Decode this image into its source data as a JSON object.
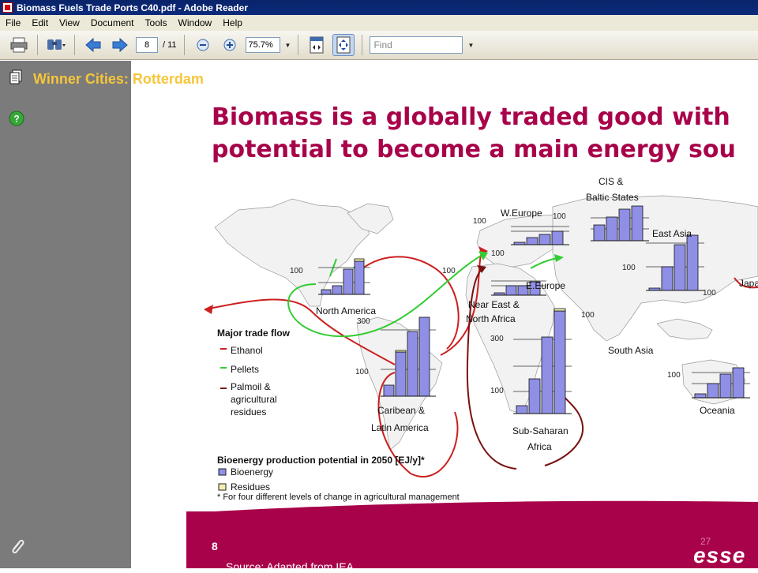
{
  "window": {
    "title": "Biomass Fuels Trade Ports C40.pdf - Adobe Reader"
  },
  "menu": [
    "File",
    "Edit",
    "View",
    "Document",
    "Tools",
    "Window",
    "Help"
  ],
  "toolbar": {
    "page_current": "8",
    "page_total": "/ 11",
    "zoom": "75.7%",
    "find_placeholder": "Find"
  },
  "sidebar": {
    "bookmark_title": "Winner Cities: Rotterdam"
  },
  "slide": {
    "title_line1": "Biomass is a globally traded good with",
    "title_line2": "potential to become a main energy sou",
    "page_number": "8",
    "page_number_right": "27",
    "source": "Source: Adapted from IEA",
    "logo": "esse"
  },
  "map": {
    "regions": {
      "north_america": "North America",
      "caribbean_1": "Caribean &",
      "caribbean_2": "Latin America",
      "w_europe": "W.Europe",
      "e_europe": "E.Europe",
      "cis_1": "CIS &",
      "cis_2": "Baltic States",
      "east_asia": "East Asia",
      "japan": "Japa",
      "near_east_1": "Near East &",
      "near_east_2": "North Africa",
      "south_asia": "South Asia",
      "sub_saharan_1": "Sub-Saharan",
      "sub_saharan_2": "Africa",
      "oceania": "Oceania"
    },
    "scale_labels": {
      "s100": "100",
      "s300": "300"
    },
    "legend": {
      "heading": "Major trade flow",
      "ethanol": "Ethanol",
      "pellets": "Pellets",
      "palmoil_1": "Palmoil &",
      "palmoil_2": "agricultural",
      "palmoil_3": "residues",
      "production_heading": "Bioenergy production potential in 2050 [EJ/y]*",
      "bioenergy": "Bioenergy",
      "residues": "Residues",
      "footnote": "* For four different levels of change in agricultural management"
    },
    "colors": {
      "ethanol": "#cc1f1f",
      "pellets": "#33cc33",
      "palmoil": "#7a1010",
      "bar": "#8f8fe6",
      "residue": "#f5f0b0"
    }
  }
}
